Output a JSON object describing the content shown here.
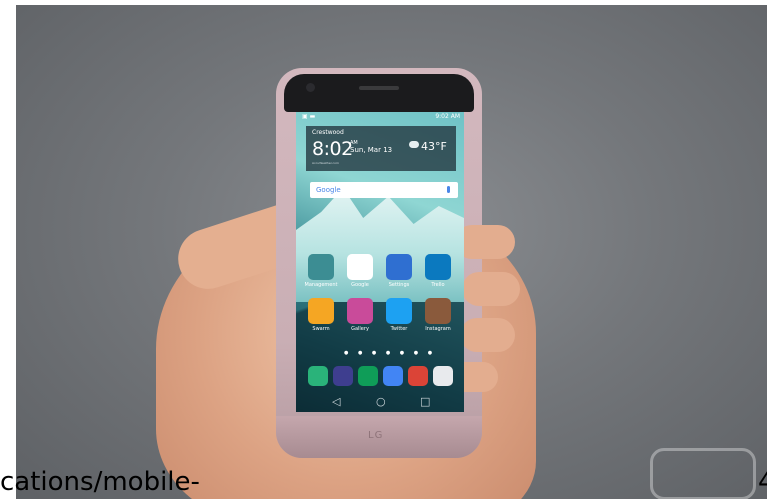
{
  "photo": {
    "subject": "hand-holding-smartphone",
    "phone_logo": "LG"
  },
  "status_bar": {
    "time": "9:02 AM"
  },
  "widget": {
    "location": "Crestwood",
    "time": "8:02",
    "ampm": "AM",
    "date": "Sun, Mar 13",
    "temperature": "43°F",
    "source": "AccuWeather.com"
  },
  "search": {
    "brand": "Google"
  },
  "apps": [
    {
      "label": "Management",
      "color": "#3c8d93"
    },
    {
      "label": "Google",
      "color": "#ffffff"
    },
    {
      "label": "Settings",
      "color": "#2f6fd1"
    },
    {
      "label": "Trello",
      "color": "#0b79bf"
    },
    {
      "label": "Swarm",
      "color": "#f5a623"
    },
    {
      "label": "Gallery",
      "color": "#c94b9a"
    },
    {
      "label": "Twitter",
      "color": "#1da1f2"
    },
    {
      "label": "Instagram",
      "color": "#8a5a3c"
    }
  ],
  "dock": [
    {
      "name": "phone-app",
      "color": "#2ab37a"
    },
    {
      "name": "camera-app",
      "color": "#3e3e8f"
    },
    {
      "name": "hangouts-app",
      "color": "#0f9d58"
    },
    {
      "name": "inbox-app",
      "color": "#4285f4"
    },
    {
      "name": "chrome-beta-app",
      "color": "#db4437"
    },
    {
      "name": "apps-folder",
      "color": "#e8eaed"
    }
  ],
  "nav": {
    "back": "◁",
    "home": "○",
    "recents": "□"
  },
  "caption": {
    "left": "cations/mobile-",
    "right": "4"
  }
}
